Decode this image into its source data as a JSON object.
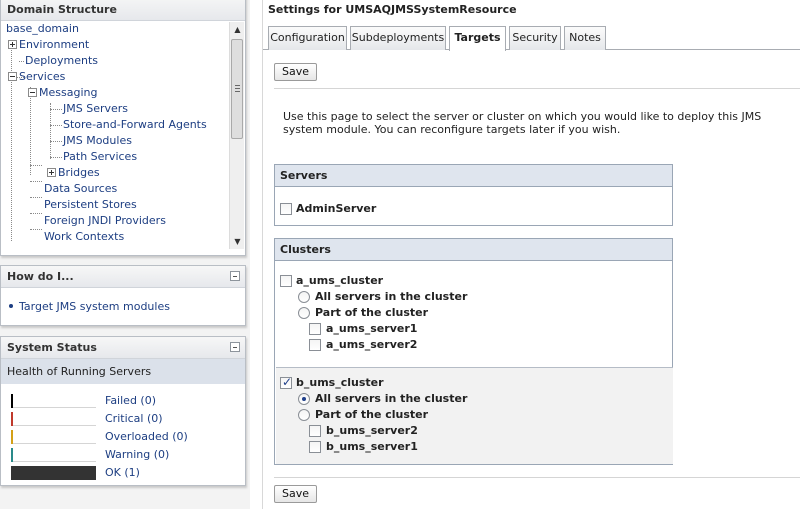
{
  "domain_panel": {
    "title": "Domain Structure",
    "tree": [
      {
        "label": "base_domain"
      },
      {
        "label": "Environment",
        "expander": "plus"
      },
      {
        "label": "Deployments"
      },
      {
        "label": "Services",
        "expander": "minus"
      },
      {
        "label": "Messaging",
        "expander": "minus"
      },
      {
        "label": "JMS Servers"
      },
      {
        "label": "Store-and-Forward Agents"
      },
      {
        "label": "JMS Modules"
      },
      {
        "label": "Path Services"
      },
      {
        "label": "Bridges",
        "expander": "plus"
      },
      {
        "label": "Data Sources"
      },
      {
        "label": "Persistent Stores"
      },
      {
        "label": "Foreign JNDI Providers"
      },
      {
        "label": "Work Contexts"
      }
    ]
  },
  "howdo_panel": {
    "title": "How do I...",
    "links": [
      "Target JMS system modules"
    ]
  },
  "status_panel": {
    "title": "System Status",
    "subtitle": "Health of Running Servers",
    "rows": [
      {
        "label": "Failed (0)",
        "color": "#000000",
        "fraction": 0
      },
      {
        "label": "Critical (0)",
        "color": "#c0392b",
        "fraction": 0
      },
      {
        "label": "Overloaded (0)",
        "color": "#d4a017",
        "fraction": 0
      },
      {
        "label": "Warning (0)",
        "color": "#2a8a8a",
        "fraction": 0
      },
      {
        "label": "OK (1)",
        "color": "#333333",
        "fraction": 1
      }
    ]
  },
  "page": {
    "title": "Settings for UMSAQJMSSystemResource",
    "tabs": [
      "Configuration",
      "Subdeployments",
      "Targets",
      "Security",
      "Notes"
    ],
    "active_tab": "Targets",
    "save_label": "Save",
    "intro": "Use this page to select the server or cluster on which you would like to deploy this JMS system module. You can reconfigure targets later if you wish."
  },
  "servers": {
    "header": "Servers",
    "items": [
      {
        "label": "AdminServer",
        "checked": false
      }
    ]
  },
  "clusters": {
    "header": "Clusters",
    "items": [
      {
        "label": "a_ums_cluster",
        "checked": false,
        "all_label": "All servers in the cluster",
        "part_label": "Part of the cluster",
        "mode": "none",
        "servers": [
          "a_ums_server1",
          "a_ums_server2"
        ]
      },
      {
        "label": "b_ums_cluster",
        "checked": true,
        "all_label": "All servers in the cluster",
        "part_label": "Part of the cluster",
        "mode": "all",
        "servers": [
          "b_ums_server2",
          "b_ums_server1"
        ]
      }
    ]
  }
}
